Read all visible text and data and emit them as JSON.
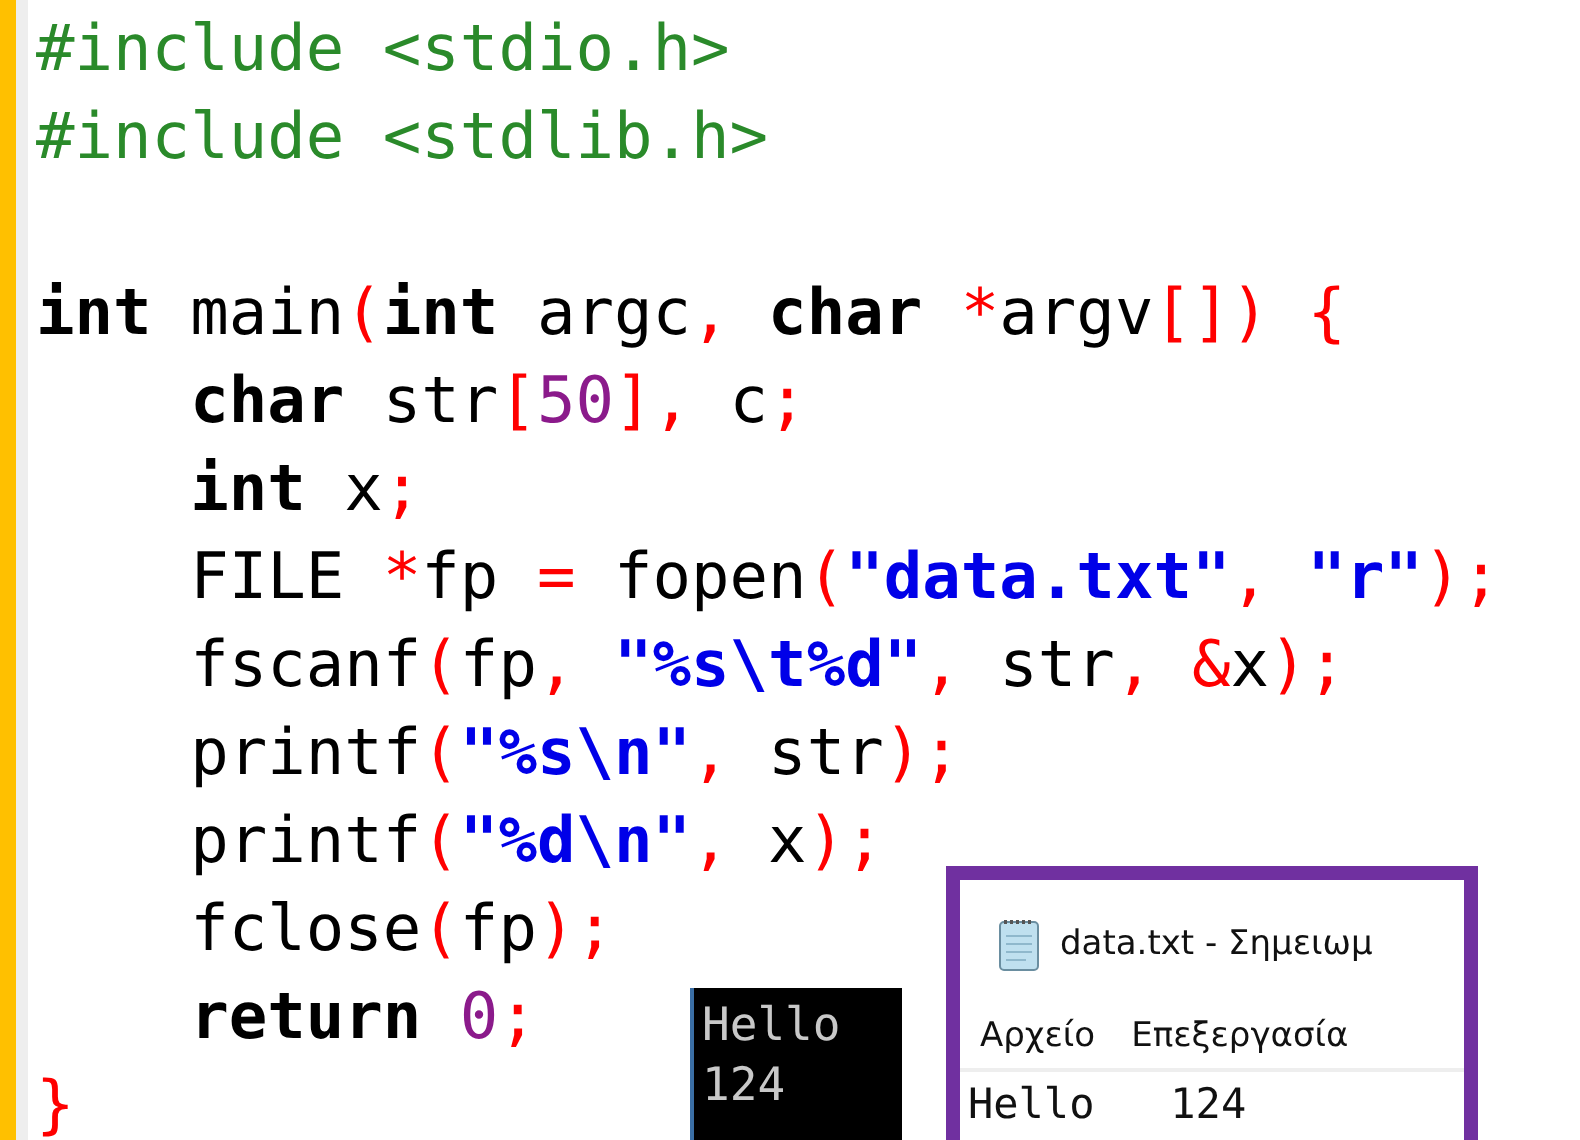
{
  "code": {
    "lines": [
      {
        "kind": "code",
        "tokens": [
          {
            "kind": "pre",
            "text": "#include <stdio.h>"
          }
        ]
      },
      {
        "kind": "code",
        "tokens": [
          {
            "kind": "pre",
            "text": "#include <stdlib.h>"
          }
        ]
      },
      {
        "kind": "blank"
      },
      {
        "kind": "code",
        "tokens": [
          {
            "kind": "kw",
            "text": "int"
          },
          {
            "kind": "plain",
            "text": " main"
          },
          {
            "kind": "op",
            "text": "("
          },
          {
            "kind": "kw",
            "text": "int"
          },
          {
            "kind": "plain",
            "text": " argc"
          },
          {
            "kind": "op",
            "text": ","
          },
          {
            "kind": "kw",
            "text": " char"
          },
          {
            "kind": "op",
            "text": " *"
          },
          {
            "kind": "plain",
            "text": "argv"
          },
          {
            "kind": "op",
            "text": "[]) {"
          }
        ]
      },
      {
        "kind": "code",
        "tokens": [
          {
            "kind": "kw",
            "text": "    char"
          },
          {
            "kind": "plain",
            "text": " str"
          },
          {
            "kind": "op",
            "text": "["
          },
          {
            "kind": "num",
            "text": "50"
          },
          {
            "kind": "op",
            "text": "],"
          },
          {
            "kind": "plain",
            "text": " c"
          },
          {
            "kind": "op",
            "text": ";"
          }
        ]
      },
      {
        "kind": "code",
        "tokens": [
          {
            "kind": "kw",
            "text": "    int"
          },
          {
            "kind": "plain",
            "text": " x"
          },
          {
            "kind": "op",
            "text": ";"
          }
        ]
      },
      {
        "kind": "code",
        "tokens": [
          {
            "kind": "plain",
            "text": "    FILE "
          },
          {
            "kind": "op",
            "text": "*"
          },
          {
            "kind": "plain",
            "text": "fp "
          },
          {
            "kind": "op",
            "text": "="
          },
          {
            "kind": "plain",
            "text": " fopen"
          },
          {
            "kind": "op",
            "text": "("
          },
          {
            "kind": "str",
            "text": "\"data.txt\""
          },
          {
            "kind": "op",
            "text": ","
          },
          {
            "kind": "str",
            "text": " \"r\""
          },
          {
            "kind": "op",
            "text": ");"
          }
        ]
      },
      {
        "kind": "code",
        "tokens": [
          {
            "kind": "plain",
            "text": "    fscanf"
          },
          {
            "kind": "op",
            "text": "("
          },
          {
            "kind": "plain",
            "text": "fp"
          },
          {
            "kind": "op",
            "text": ","
          },
          {
            "kind": "str",
            "text": " \"%s\\t%d\""
          },
          {
            "kind": "op",
            "text": ","
          },
          {
            "kind": "plain",
            "text": " str"
          },
          {
            "kind": "op",
            "text": ", &"
          },
          {
            "kind": "plain",
            "text": "x"
          },
          {
            "kind": "op",
            "text": ");"
          }
        ]
      },
      {
        "kind": "code",
        "tokens": [
          {
            "kind": "plain",
            "text": "    printf"
          },
          {
            "kind": "op",
            "text": "("
          },
          {
            "kind": "str",
            "text": "\"%s\\n\""
          },
          {
            "kind": "op",
            "text": ","
          },
          {
            "kind": "plain",
            "text": " str"
          },
          {
            "kind": "op",
            "text": ");"
          }
        ]
      },
      {
        "kind": "code",
        "tokens": [
          {
            "kind": "plain",
            "text": "    printf"
          },
          {
            "kind": "op",
            "text": "("
          },
          {
            "kind": "str",
            "text": "\"%d\\n\""
          },
          {
            "kind": "op",
            "text": ","
          },
          {
            "kind": "plain",
            "text": " x"
          },
          {
            "kind": "op",
            "text": ");"
          }
        ]
      },
      {
        "kind": "code",
        "tokens": [
          {
            "kind": "plain",
            "text": "    fclose"
          },
          {
            "kind": "op",
            "text": "("
          },
          {
            "kind": "plain",
            "text": "fp"
          },
          {
            "kind": "op",
            "text": ");"
          }
        ]
      },
      {
        "kind": "code",
        "tokens": [
          {
            "kind": "kw",
            "text": "    return"
          },
          {
            "kind": "num",
            "text": " 0"
          },
          {
            "kind": "op",
            "text": ";"
          }
        ]
      },
      {
        "kind": "code",
        "tokens": [
          {
            "kind": "op",
            "text": "}"
          }
        ]
      }
    ]
  },
  "console": {
    "lines": [
      "Hello",
      "124"
    ]
  },
  "notepad": {
    "title": "data.txt - Σημειωμ",
    "menu": [
      "Αρχείο",
      "Επεξεργασία"
    ],
    "content": "Hello\t124"
  }
}
